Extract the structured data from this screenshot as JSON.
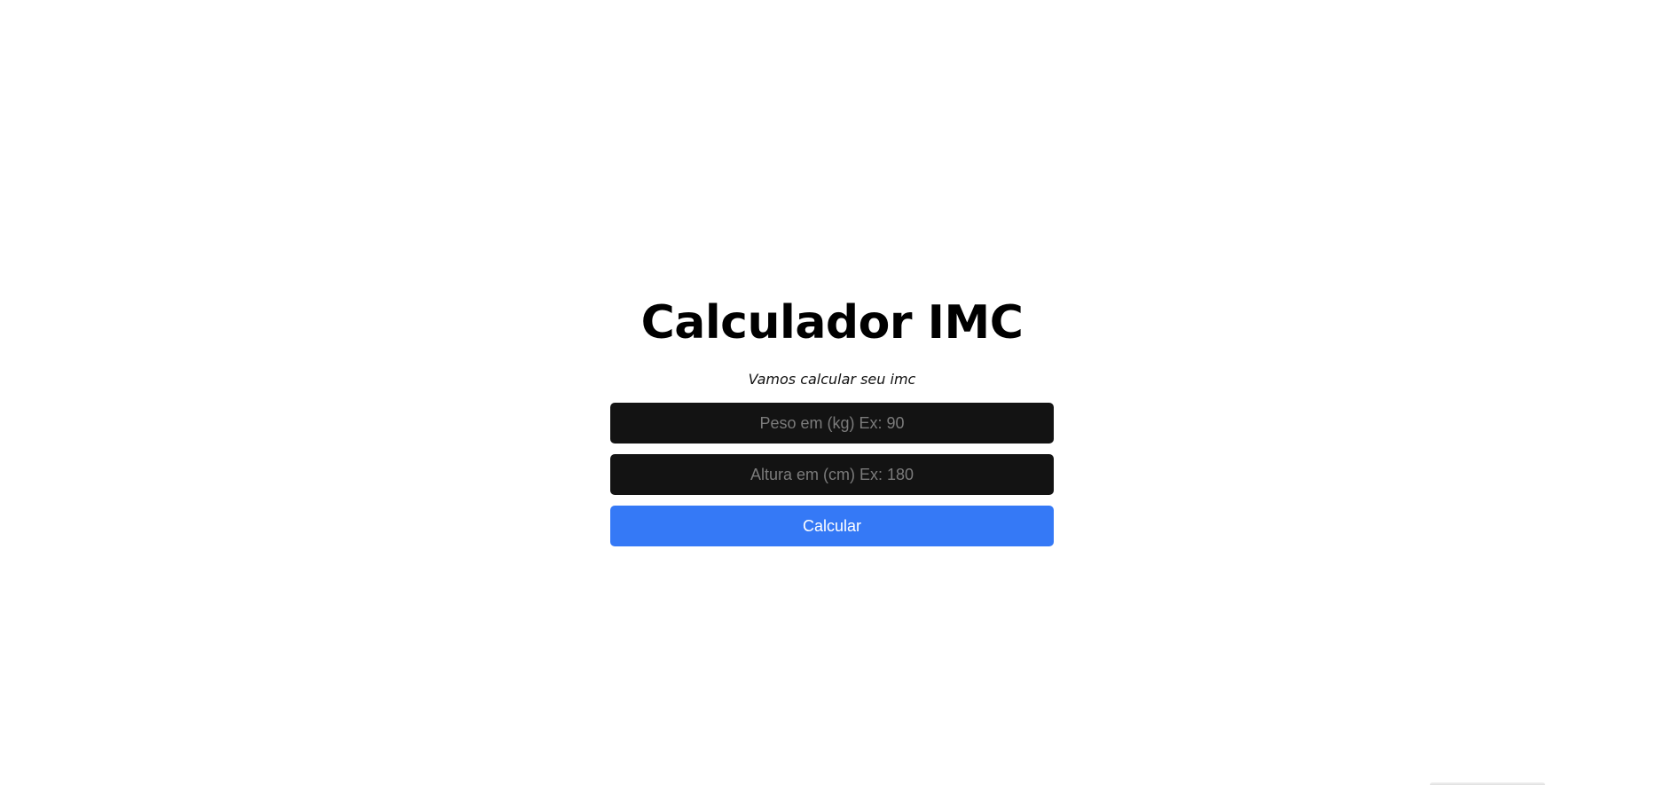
{
  "header": {
    "title": "Calculador IMC",
    "subtitle": "Vamos calcular seu imc"
  },
  "form": {
    "weight": {
      "value": "",
      "placeholder": "Peso em (kg) Ex: 90"
    },
    "height": {
      "value": "",
      "placeholder": "Altura em (cm) Ex: 180"
    },
    "submit_label": "Calcular"
  },
  "colors": {
    "background": "#ffffff",
    "input_background": "#131313",
    "placeholder": "#7b7b7b",
    "button_accent": "#3579f6",
    "button_text": "#ffffff",
    "title_text": "#000000"
  }
}
